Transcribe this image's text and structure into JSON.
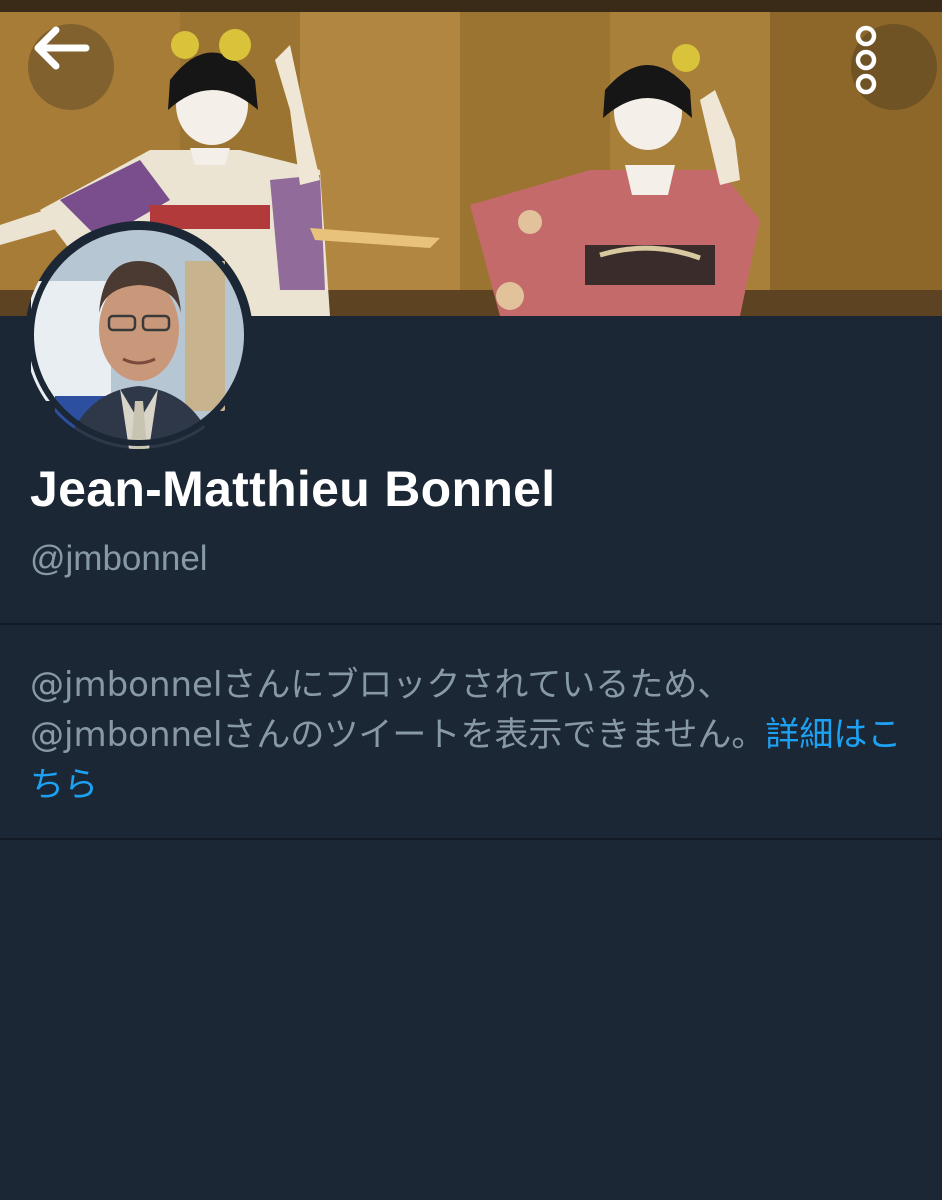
{
  "header": {
    "back_icon": "arrow-left-icon",
    "more_icon": "vertical-dots-icon"
  },
  "profile": {
    "name": "Jean-Matthieu Bonnel",
    "handle": "@jmbonnel"
  },
  "notice": {
    "line1": "@jmbonnelさんにブロックされているため、",
    "line2": "@jmbonnelさんのツイートを表示できません。",
    "link": "詳細はこちら"
  },
  "colors": {
    "background": "#1b2735",
    "secondary_text": "#8899a6",
    "link": "#1da1f2",
    "primary_text": "#ffffff"
  }
}
